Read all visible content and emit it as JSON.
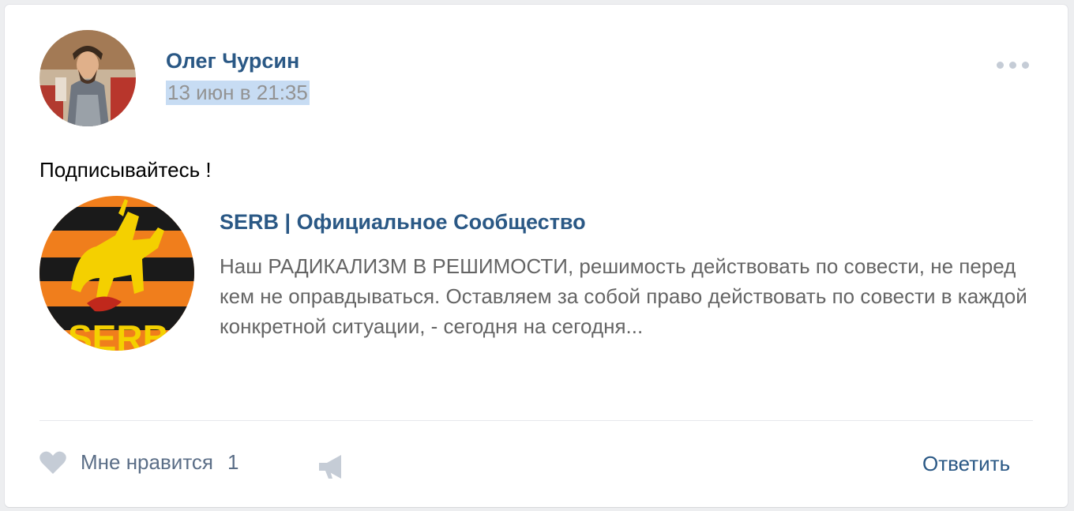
{
  "post": {
    "author": "Олег Чурсин",
    "date": "13 июн в 21:35",
    "text": "Подписывайтесь !"
  },
  "attachment": {
    "group_name": "SERB | Официальное Сообщество",
    "description": "Наш РАДИКАЛИЗМ В РЕШИМОСТИ, решимость действовать по совести, не перед кем не оправдываться. Оставляем за собой право действовать по совести в каждой конкретной ситуации, - сегодня на сегодня..."
  },
  "actions": {
    "like_label": "Мне нравится",
    "like_count": "1",
    "reply_label": "Ответить"
  },
  "icons": {
    "like": "heart-icon",
    "share": "megaphone-icon",
    "more": "more-icon"
  },
  "colors": {
    "link": "#2a5885",
    "muted": "#939393",
    "date_highlight": "#c7dcf3",
    "icon": "#c5ccd6"
  }
}
